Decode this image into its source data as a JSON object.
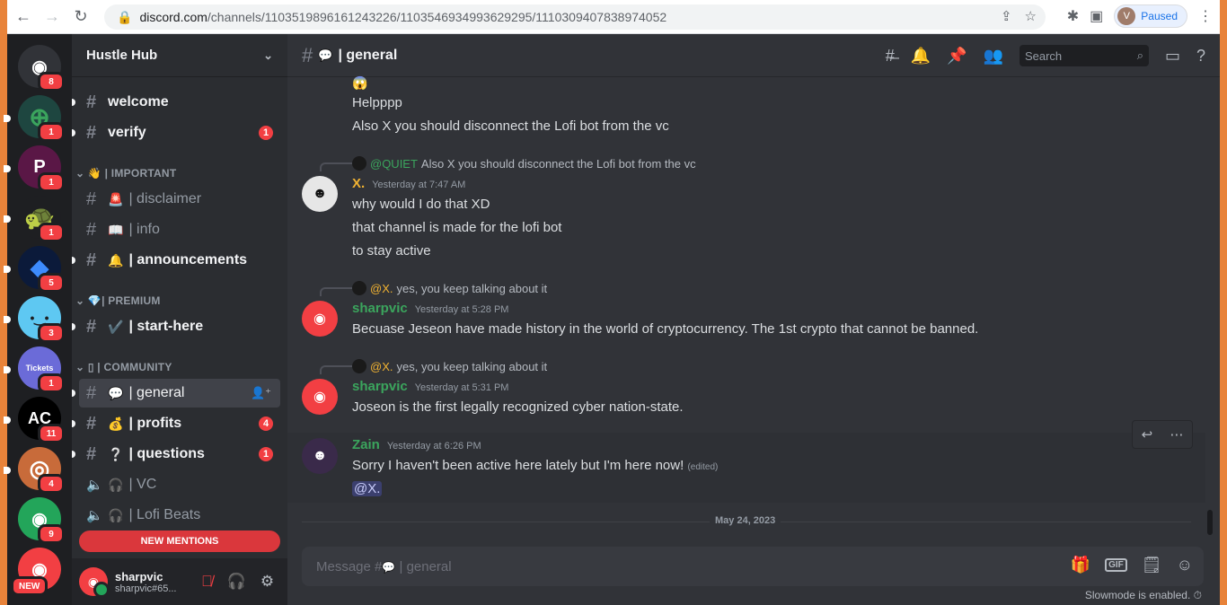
{
  "browser": {
    "url_host": "discord.com",
    "url_path": "/channels/1103519896161243226/1103546934993629295/1110309407838974052",
    "profile_initial": "V",
    "profile_status": "Paused"
  },
  "servers": [
    {
      "name": "discord-home",
      "glyph": "◉",
      "badge": "8",
      "color": "#313338"
    },
    {
      "name": "server-add",
      "glyph": "⊕",
      "badge": "1",
      "color": "#1e4640"
    },
    {
      "name": "server-p",
      "glyph": "P",
      "badge": "1",
      "color": "#5a1746"
    },
    {
      "name": "server-turtle",
      "glyph": "🐢",
      "badge": "1",
      "color": "#1e1f22"
    },
    {
      "name": "server-diamond",
      "glyph": "◆",
      "badge": "5",
      "color": "#0b1a3a"
    },
    {
      "name": "server-blue-face",
      "glyph": "•‿•",
      "badge": "3",
      "color": "#5ec8f2"
    },
    {
      "name": "server-tickets",
      "glyph": "Tickets",
      "badge": "1",
      "color": "#6b6bd8"
    },
    {
      "name": "server-ac",
      "glyph": "AC",
      "badge": "11",
      "color": "#000000"
    },
    {
      "name": "server-ring",
      "glyph": "◎",
      "badge": "4",
      "color": "#c86b3a"
    },
    {
      "name": "server-green",
      "glyph": "◉",
      "badge": "9",
      "color": "#23a55a"
    },
    {
      "name": "server-red",
      "glyph": "◉",
      "badge": "NEW",
      "color": "#f23f43"
    }
  ],
  "guild": {
    "name": "Hustle Hub",
    "channels": {
      "welcome": "welcome",
      "verify": "verify",
      "verify_badge": "1",
      "cat_important": "| IMPORTANT",
      "disclaimer": "| disclaimer",
      "info": "| info",
      "announcements": "| announcements",
      "cat_premium": "| PREMIUM",
      "start_here": "| start-here",
      "cat_community": "| COMMUNITY",
      "general": "| general",
      "profits": "| profits",
      "profits_badge": "4",
      "questions": "| questions",
      "questions_badge": "1",
      "vc": "| VC",
      "lofi": "| Lofi Beats"
    },
    "new_mentions": "NEW MENTIONS"
  },
  "user_panel": {
    "name": "sharpvic",
    "tag": "sharpvic#65..."
  },
  "channel_header": {
    "name": "| general",
    "search_placeholder": "Search"
  },
  "messages": {
    "m0_line1": "Helpppp",
    "m0_line2": "Also X you should disconnect the Lofi bot from the vc",
    "m1_reply_author": "@QUIET",
    "m1_reply_text": "Also X you should disconnect the Lofi bot from the vc",
    "m1_author": "X.",
    "m1_time": "Yesterday at 7:47 AM",
    "m1_line1": "why would I do that XD",
    "m1_line2": "that channel is made for the lofi bot",
    "m1_line3": "to stay active",
    "m2_reply_author": "@X.",
    "m2_reply_text": "yes, you keep talking about it",
    "m2_author": "sharpvic",
    "m2_time": "Yesterday at 5:28 PM",
    "m2_line1": "Becuase Jeseon have made history in the world of cryptocurrency. The 1st crypto that cannot be banned.",
    "m3_reply_author": "@X.",
    "m3_reply_text": "yes, you keep talking about it",
    "m3_author": "sharpvic",
    "m3_time": "Yesterday at 5:31 PM",
    "m3_line1": "Joseon is the first legally recognized cyber nation-state.",
    "m4_author": "Zain",
    "m4_time": "Yesterday at 6:26 PM",
    "m4_line1": "Sorry I haven't been active here lately but I'm here now!",
    "m4_edited": "(edited)",
    "m4_mention": "@X."
  },
  "date_divider": "May 24, 2023",
  "composer": {
    "placeholder_prefix": "Message #",
    "placeholder_channel": "| general",
    "gif_label": "GIF",
    "slowmode": "Slowmode is enabled."
  }
}
